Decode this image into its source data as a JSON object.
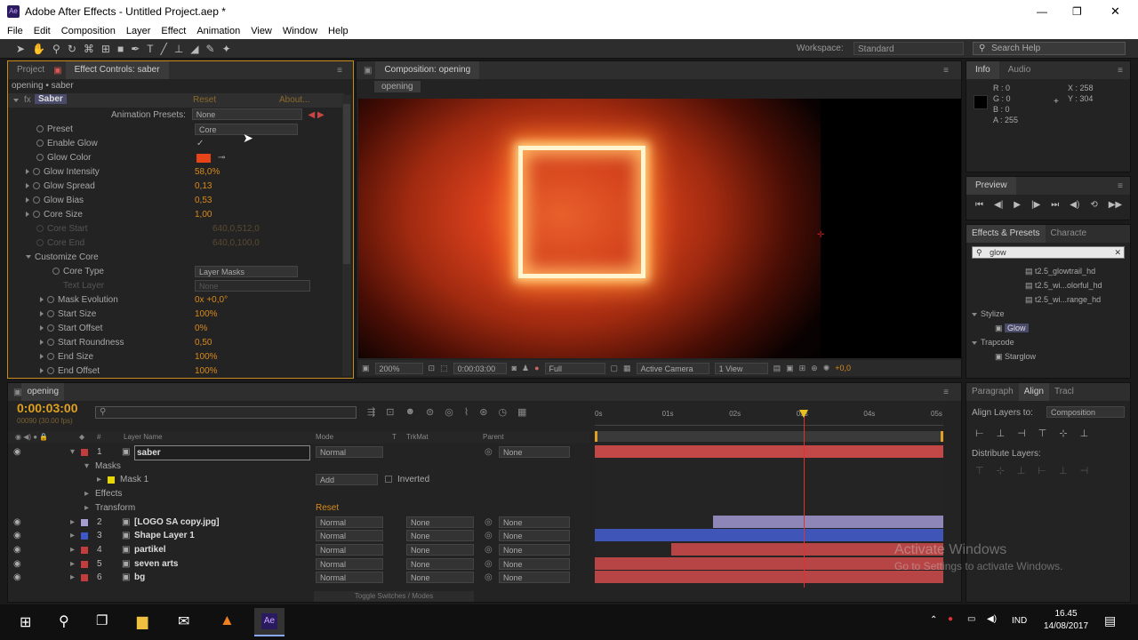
{
  "window": {
    "title": "Adobe After Effects - Untitled Project.aep *",
    "min": "—",
    "max": "❐",
    "close": "✕"
  },
  "menu": [
    "File",
    "Edit",
    "Composition",
    "Layer",
    "Effect",
    "Animation",
    "View",
    "Window",
    "Help"
  ],
  "toolbar": {
    "workspace_label": "Workspace:",
    "workspace_value": "Standard",
    "search_placeholder": "Search Help"
  },
  "effect_panel": {
    "tab_project": "Project",
    "tab_effect": "Effect Controls: saber",
    "breadcrumb": "opening • saber",
    "effect_name": "Saber",
    "reset": "Reset",
    "about": "About...",
    "anim_presets_label": "Animation Presets:",
    "anim_presets_value": "None",
    "props": [
      {
        "label": "Preset",
        "value": "Core",
        "kind": "dropdown"
      },
      {
        "label": "Enable Glow",
        "value": "✓",
        "kind": "check"
      },
      {
        "label": "Glow Color",
        "value": "",
        "kind": "color",
        "color": "#e8441a"
      },
      {
        "label": "Glow Intensity",
        "value": "58,0%",
        "kind": "value"
      },
      {
        "label": "Glow Spread",
        "value": "0,13",
        "kind": "value"
      },
      {
        "label": "Glow Bias",
        "value": "0,53",
        "kind": "value"
      },
      {
        "label": "Core Size",
        "value": "1,00",
        "kind": "value"
      },
      {
        "label": "Core Start",
        "value": "640,0,512,0",
        "kind": "disabled"
      },
      {
        "label": "Core End",
        "value": "640,0,100,0",
        "kind": "disabled"
      }
    ],
    "customize_core": "Customize Core",
    "core_type_label": "Core Type",
    "core_type_value": "Layer Masks",
    "text_layer_label": "Text Layer",
    "text_layer_value": "None",
    "sub_props": [
      {
        "label": "Mask Evolution",
        "value": "0x +0,0°"
      },
      {
        "label": "Start Size",
        "value": "100%"
      },
      {
        "label": "Start Offset",
        "value": "0%"
      },
      {
        "label": "Start Roundness",
        "value": "0,50"
      },
      {
        "label": "End Size",
        "value": "100%"
      },
      {
        "label": "End Offset",
        "value": "100%"
      }
    ]
  },
  "comp_panel": {
    "tab": "Composition: opening",
    "subtab": "opening",
    "zoom": "200%",
    "timecode": "0:00:03:00",
    "resolution": "Full",
    "camera": "Active Camera",
    "views": "1 View",
    "exposure": "+0,0"
  },
  "info_panel": {
    "tab_info": "Info",
    "tab_audio": "Audio",
    "r": "R : 0",
    "g": "G : 0",
    "b": "B : 0",
    "a": "A : 255",
    "x": "X : 258",
    "y": "Y : 304"
  },
  "preview_panel": {
    "tab": "Preview"
  },
  "effects_presets": {
    "tab": "Effects & Presets",
    "tab2": "Characte",
    "search_value": "glow",
    "items": [
      {
        "label": "t2.5_glowtrail_hd",
        "indent": 2
      },
      {
        "label": "t2.5_wi...olorful_hd",
        "indent": 2
      },
      {
        "label": "t2.5_wi...range_hd",
        "indent": 2
      },
      {
        "label": "Stylize",
        "indent": 0,
        "folder": true
      },
      {
        "label": "Glow",
        "indent": 1,
        "selected": true
      },
      {
        "label": "Trapcode",
        "indent": 0,
        "folder": true
      },
      {
        "label": "Starglow",
        "indent": 1
      }
    ]
  },
  "align_panel": {
    "tab_paragraph": "Paragraph",
    "tab_align": "Align",
    "tab_tracker": "Tracl",
    "align_to_label": "Align Layers to:",
    "align_to_value": "Composition",
    "distribute_label": "Distribute Layers:"
  },
  "timeline": {
    "tab": "opening",
    "timecode": "0:00:03:00",
    "frames": "00090 (30.00 fps)",
    "headers": {
      "layer_name": "Layer Name",
      "mode": "Mode",
      "t": "T",
      "trkmat": "TrkMat",
      "parent": "Parent"
    },
    "ruler": [
      "0s",
      "01s",
      "02s",
      "03s",
      "04s",
      "05s"
    ],
    "layers": [
      {
        "num": "1",
        "name": "saber",
        "color": "#c43c3c",
        "mode": "Normal",
        "trkmat": "",
        "parent": "None",
        "bar_color": "#c24848",
        "bar_start": 0.0,
        "bar_end": 1.0,
        "selected": true
      },
      {
        "num": "",
        "name": "Masks",
        "color": "",
        "mode": "",
        "trkmat": "",
        "parent": "",
        "sub": 1
      },
      {
        "num": "",
        "name": "Mask 1",
        "color": "#e8d800",
        "mode": "Add",
        "trkmat": "Inverted",
        "parent": "",
        "sub": 2
      },
      {
        "num": "",
        "name": "Effects",
        "color": "",
        "mode": "",
        "trkmat": "",
        "parent": "",
        "sub": 1
      },
      {
        "num": "",
        "name": "Transform",
        "color": "",
        "mode": "",
        "trkmat": "",
        "parent": "",
        "sub": 1,
        "reset": "Reset"
      },
      {
        "num": "2",
        "name": "[LOGO SA copy.jpg]",
        "color": "#a79ecf",
        "mode": "Normal",
        "trkmat": "None",
        "parent": "None",
        "bar_color": "#8f86b8",
        "bar_start": 0.34,
        "bar_end": 1.0
      },
      {
        "num": "3",
        "name": "Shape Layer 1",
        "color": "#3c58c8",
        "mode": "Normal",
        "trkmat": "None",
        "parent": "None",
        "bar_color": "#3f55b8",
        "bar_start": 0.0,
        "bar_end": 1.0
      },
      {
        "num": "4",
        "name": "partikel",
        "color": "#c43c3c",
        "mode": "Normal",
        "trkmat": "None",
        "parent": "None",
        "bar_color": "#b84545",
        "bar_start": 0.22,
        "bar_end": 1.0
      },
      {
        "num": "5",
        "name": "seven arts",
        "color": "#c43c3c",
        "mode": "Normal",
        "trkmat": "None",
        "parent": "None",
        "bar_color": "#b84545",
        "bar_start": 0.0,
        "bar_end": 1.0
      },
      {
        "num": "6",
        "name": "bg",
        "color": "#c43c3c",
        "mode": "Normal",
        "trkmat": "None",
        "parent": "None",
        "bar_color": "#b84545",
        "bar_start": 0.0,
        "bar_end": 1.0
      }
    ],
    "playhead": 0.6,
    "toggle_label": "Toggle Switches / Modes"
  },
  "watermark": {
    "line1": "Activate Windows",
    "line2": "Go to Settings to activate Windows."
  },
  "taskbar": {
    "time": "16.45",
    "date": "14/08/2017",
    "lang": "IND",
    "ae_label": "Ae"
  }
}
